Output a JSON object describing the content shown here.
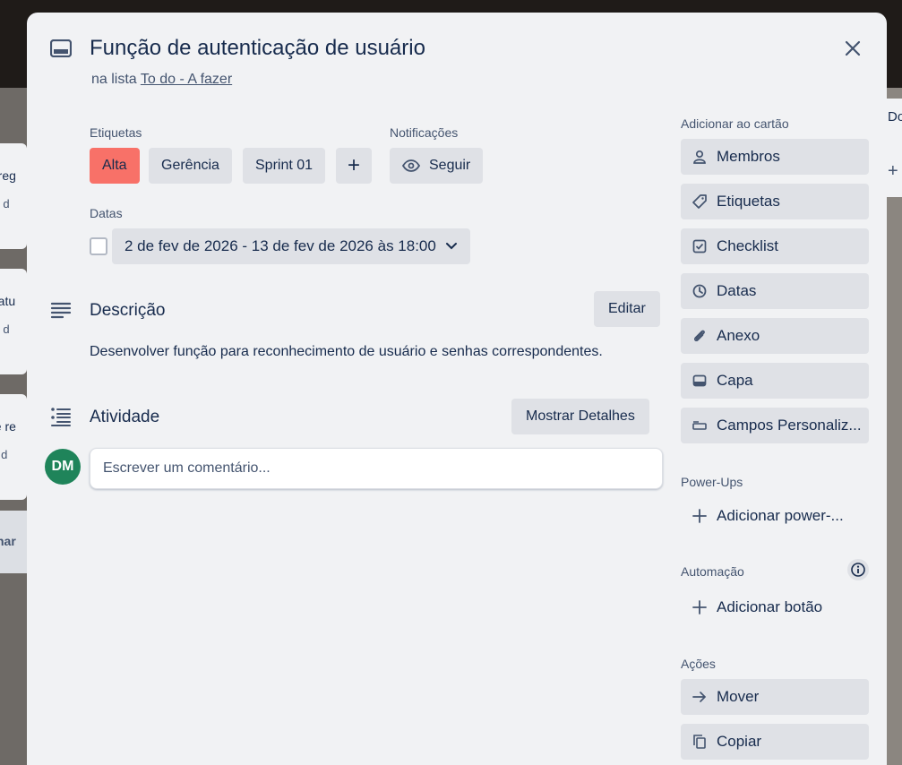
{
  "card": {
    "title": "Função de autenticação de usuário",
    "list_prefix": "na lista",
    "list_name": "To do - A fazer"
  },
  "labels": {
    "heading": "Etiquetas",
    "items": [
      "Alta",
      "Gerência",
      "Sprint 01"
    ],
    "add": "+"
  },
  "notifications": {
    "heading": "Notificações",
    "follow": "Seguir"
  },
  "dates": {
    "heading": "Datas",
    "value": "2 de fev de 2026 - 13 de fev de 2026 às 18:00"
  },
  "description": {
    "heading": "Descrição",
    "edit": "Editar",
    "text": "Desenvolver função para reconhecimento de usuário e senhas correspondentes."
  },
  "activity": {
    "heading": "Atividade",
    "show_details": "Mostrar Detalhes",
    "avatar_initials": "DM",
    "comment_placeholder": "Escrever um comentário..."
  },
  "sidebar": {
    "add_to_card": "Adicionar ao cartão",
    "items": [
      "Membros",
      "Etiquetas",
      "Checklist",
      "Datas",
      "Anexo",
      "Capa",
      "Campos Personaliz..."
    ],
    "powerups_heading": "Power-Ups",
    "add_powerup": "Adicionar power-...",
    "automation_heading": "Automação",
    "add_button": "Adicionar botão",
    "actions_heading": "Ações",
    "actions": [
      "Mover",
      "Copiar"
    ]
  },
  "background": {
    "cards": [
      {
        "line1": "e reg",
        "line2": "ev d"
      },
      {
        "line1": "e atu",
        "line2": "ev d"
      },
      {
        "line1": "de re",
        "line2": "ar d"
      }
    ],
    "bottom_text": "nar",
    "right_text": "Do"
  },
  "colors": {
    "label_alta": "#f87168",
    "avatar": "#1f845a",
    "modal_bg": "#f1f2f4",
    "button_bg": "#dfe1e6"
  }
}
